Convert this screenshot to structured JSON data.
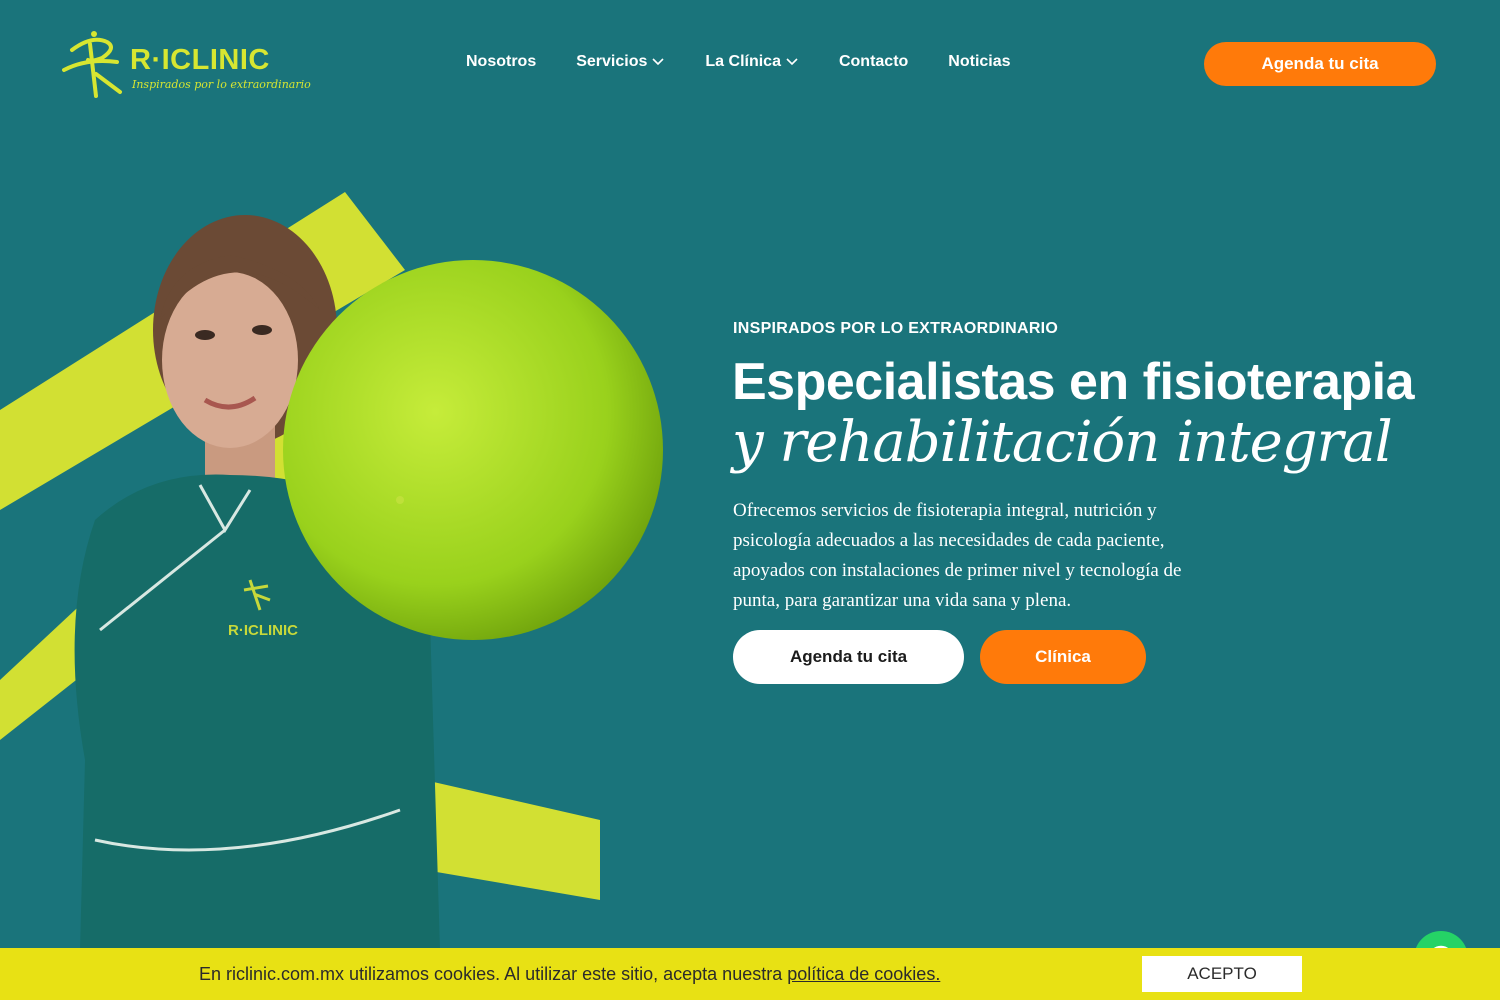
{
  "header": {
    "logo_text": "R·ICLINIC",
    "logo_tagline": "Inspirados por lo extraordinario",
    "nav": [
      {
        "label": "Nosotros",
        "has_dropdown": false
      },
      {
        "label": "Servicios",
        "has_dropdown": true
      },
      {
        "label": "La Clínica",
        "has_dropdown": true
      },
      {
        "label": "Contacto",
        "has_dropdown": false
      },
      {
        "label": "Noticias",
        "has_dropdown": false
      }
    ],
    "cta_label": "Agenda tu cita"
  },
  "hero": {
    "eyebrow": "INSPIRADOS POR LO EXTRAORDINARIO",
    "title_line1": "Especialistas en fisioterapia",
    "title_line2": "y rehabilitación integral",
    "description": "Ofrecemos servicios de fisioterapia integral, nutrición y psicología adecuados a las necesidades de cada paciente, apoyados con instalaciones de primer nivel y tecnología de punta, para garantizar una vida sana y plena.",
    "primary_button": "Agenda tu cita",
    "secondary_button": "Clínica",
    "uniform_logo": "R·ICLINIC"
  },
  "cookie_bar": {
    "text": "En riclinic.com.mx utilizamos cookies. Al utilizar este sitio, acepta nuestra ",
    "link_text": "política de cookies.",
    "accept_label": "ACEPTO"
  },
  "colors": {
    "background": "#1a747b",
    "accent_lime": "#d7e631",
    "accent_orange": "#ff7a0a",
    "cookie_bg": "#e8e114",
    "whatsapp": "#25d366"
  },
  "icons": [
    "logo-figure-icon",
    "chevron-down-icon",
    "whatsapp-icon"
  ]
}
